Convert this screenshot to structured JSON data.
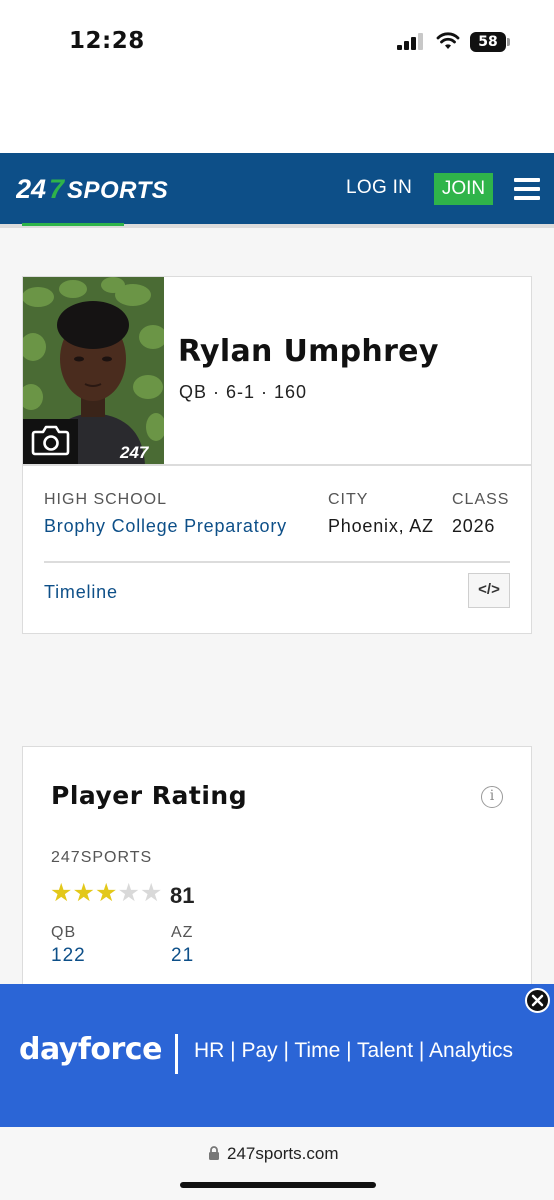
{
  "status_bar": {
    "time": "12:28",
    "battery": "58"
  },
  "header": {
    "logo_text": "247SPORTS",
    "login_label": "LOG IN",
    "join_label": "JOIN"
  },
  "player": {
    "name": "Rylan Umphrey",
    "meta": "QB · 6-1 · 160",
    "photo_watermark": "247",
    "high_school_label": "HIGH SCHOOL",
    "high_school": "Brophy College Preparatory",
    "city_label": "CITY",
    "city": "Phoenix, AZ",
    "class_label": "CLASS",
    "class": "2026",
    "timeline_label": "Timeline",
    "embed_icon": "</>"
  },
  "rating": {
    "title": "Player Rating",
    "source": "247SPORTS",
    "stars": 3,
    "stars_total": 5,
    "score": "81",
    "position_label": "QB",
    "position_rank": "122",
    "state_label": "AZ",
    "state_rank": "21",
    "info_icon": "i"
  },
  "ad": {
    "brand": "dayforce",
    "tagline": "HR | Pay | Time | Talent | Analytics"
  },
  "browser": {
    "url": "247sports.com"
  },
  "colors": {
    "brand_blue": "#0d4f88",
    "join_green": "#2fb44a",
    "star_gold": "#e3c81a",
    "ad_blue": "#2b65d6"
  }
}
